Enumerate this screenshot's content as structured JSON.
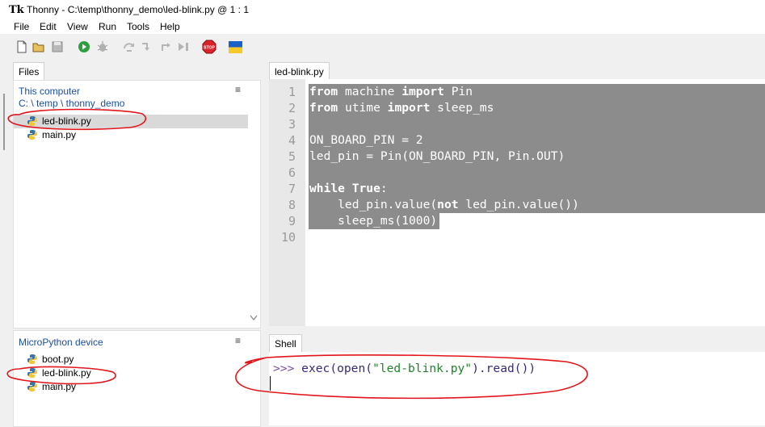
{
  "window": {
    "app_icon": "Tk",
    "title": "Thonny  -  C:\\temp\\thonny_demo\\led-blink.py  @  1 : 1"
  },
  "menu": [
    "File",
    "Edit",
    "View",
    "Run",
    "Tools",
    "Help"
  ],
  "toolbar": {
    "icons": [
      "new-file-icon",
      "open-folder-icon",
      "save-icon",
      "run-icon",
      "debug-icon",
      "step-over-icon",
      "step-into-icon",
      "step-out-icon",
      "resume-icon",
      "stop-icon",
      "ukraine-flag-icon"
    ],
    "stop_label": "STOP"
  },
  "files": {
    "tab_label": "Files",
    "this_computer": {
      "title": "This computer",
      "path": "C: \\ temp \\ thonny_demo",
      "menu_icon": "≡",
      "items": [
        "led-blink.py",
        "main.py"
      ],
      "selected": "led-blink.py"
    },
    "micropython": {
      "title": "MicroPython device",
      "menu_icon": "≡",
      "items": [
        "boot.py",
        "led-blink.py",
        "main.py"
      ]
    }
  },
  "editor": {
    "tab_label": "led-blink.py",
    "line_numbers": [
      "1",
      "2",
      "3",
      "4",
      "5",
      "6",
      "7",
      "8",
      "9",
      "10"
    ],
    "lines": [
      [
        {
          "t": "from",
          "k": true
        },
        {
          "t": " machine "
        },
        {
          "t": "import",
          "k": true
        },
        {
          "t": " Pin"
        }
      ],
      [
        {
          "t": "from",
          "k": true
        },
        {
          "t": " utime "
        },
        {
          "t": "import",
          "k": true
        },
        {
          "t": " sleep_ms"
        }
      ],
      [],
      [
        {
          "t": "ON_BOARD_PIN = 2"
        }
      ],
      [
        {
          "t": "led_pin = Pin(ON_BOARD_PIN, Pin.OUT)"
        }
      ],
      [],
      [
        {
          "t": "while",
          "k": true
        },
        {
          "t": " "
        },
        {
          "t": "True",
          "k": true
        },
        {
          "t": ":"
        }
      ],
      [
        {
          "t": "    led_pin.value("
        },
        {
          "t": "not",
          "k": true
        },
        {
          "t": " led_pin.value())"
        }
      ],
      [
        {
          "t": "    sleep_ms(1000)"
        }
      ],
      []
    ]
  },
  "shell": {
    "tab_label": "Shell",
    "prompt": ">>>",
    "cmd_fn1": "exec",
    "cmd_p1": "(",
    "cmd_fn2": "open",
    "cmd_p2": "(",
    "cmd_str": "\"led-blink.py\"",
    "cmd_rest": ").read())"
  },
  "colors": {
    "selection": "#8c8c8c",
    "annotation": "#e0161c",
    "link_blue": "#1c4e9c"
  }
}
